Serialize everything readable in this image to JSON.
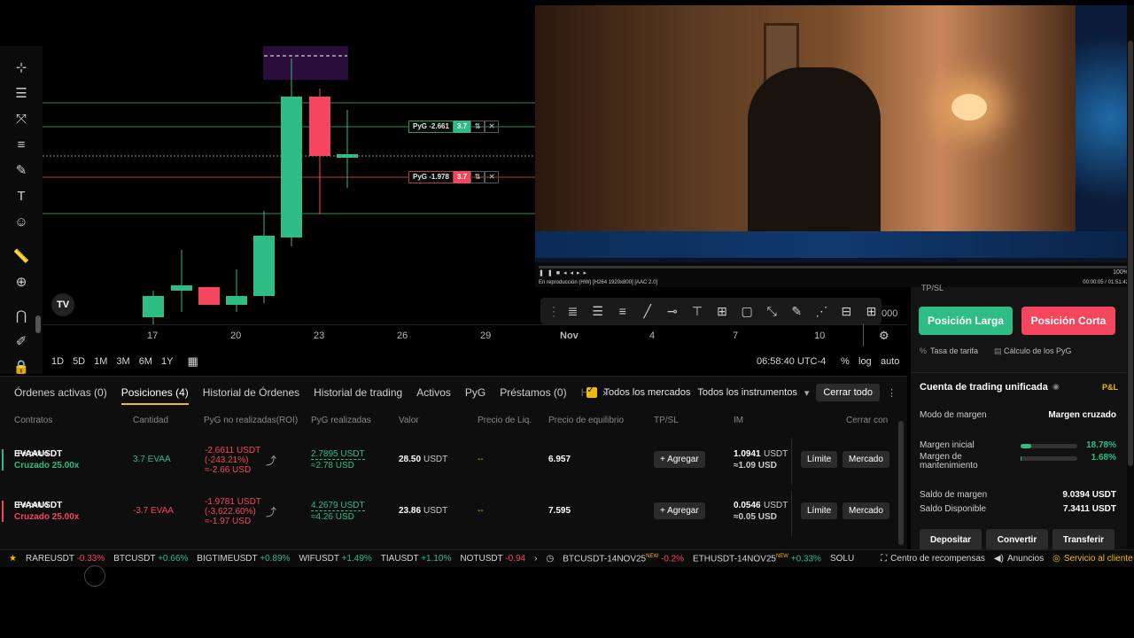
{
  "toolbar_icons": [
    "cursor-cross-icon",
    "horizontal-lines-icon",
    "pattern-icon",
    "parallel-lines-icon",
    "brush-icon",
    "text-icon",
    "emoji-icon",
    "ruler-icon",
    "zoom-in-icon",
    "magnet-icon",
    "edit-pencil-icon",
    "lock-icon"
  ],
  "chart": {
    "xaxis_ticks": [
      "17",
      "20",
      "23",
      "26",
      "29",
      "Nov",
      "4",
      "7",
      "10"
    ],
    "price_right_partial": "000",
    "pyg_long": {
      "label": "PyG -2.661",
      "qty": "3.7"
    },
    "pyg_short": {
      "label": "PyG -1.978",
      "qty": "3.7"
    },
    "timeframes": [
      "1D",
      "5D",
      "1M",
      "3M",
      "6M",
      "1Y"
    ],
    "clock": "06:58:40 UTC-4",
    "percent": "%",
    "log": "log",
    "auto": "auto",
    "colors": {
      "up": "#2ebd85",
      "down": "#f6465d"
    }
  },
  "video": {
    "status": "En reproducción (HW)   [H264 1920x800]   [AAC 2.0]",
    "time": "00:00:05 / 01:51:42",
    "volume": "100%"
  },
  "orders": {
    "tabs": [
      "Órdenes activas (0)",
      "Posiciones (4)",
      "Historial de Órdenes",
      "Historial de trading",
      "Activos",
      "PyG",
      "Préstamos (0)",
      "H"
    ],
    "active_tab": 1,
    "filter_all_markets": "Todos los mercados",
    "filter_instruments": "Todos los instrumentos",
    "close_all": "Cerrar todo",
    "headers": [
      "Contratos",
      "Cantidad",
      "PyG no realizadas(ROI)",
      "PyG realizadas",
      "Valor",
      "Precio de Liq.",
      "Precio de equilibrio",
      "TP/SL",
      "IM",
      "Cerrar con"
    ],
    "rows": [
      {
        "symbol": "EVAAUSDT",
        "type": "Perpetuo",
        "margin": "Cruzado 25.00x",
        "qty": "3.7 EVAA",
        "upnl": "-2.6611 USDT",
        "roi": "(-243.21%)",
        "upnl_usd": "≈-2.66 USD",
        "rpnl": "2.7895 USDT",
        "rpnl_usd": "≈2.78 USD",
        "value": "28.50",
        "value_unit": "USDT",
        "liq": "--",
        "entry": "6.957",
        "tpsl": "+ Agregar",
        "im": "1.0941",
        "im_unit": "USDT",
        "im_usd": "≈1.09 USD",
        "limit": "Límite",
        "market": "Mercado",
        "side": "long"
      },
      {
        "symbol": "EVAAUSDT",
        "type": "Perpetuo",
        "margin": "Cruzado 25.00x",
        "qty": "-3.7 EVAA",
        "upnl": "-1.9781 USDT",
        "roi": "(-3,622.60%)",
        "upnl_usd": "≈-1.97 USD",
        "rpnl": "4.2679 USDT",
        "rpnl_usd": "≈4.26 USD",
        "value": "23.86",
        "value_unit": "USDT",
        "liq": "--",
        "entry": "7.595",
        "tpsl": "+ Agregar",
        "im": "0.0546",
        "im_unit": "USDT",
        "im_usd": "≈0.05 USD",
        "limit": "Límite",
        "market": "Mercado",
        "side": "short"
      }
    ]
  },
  "trade_panel": {
    "tpsl_partial": "TP/SL",
    "long_btn": "Posición Larga",
    "short_btn": "Posición Corta",
    "fee_rate": "Tasa de tarifa",
    "pnl_calc": "Cálculo de los PyG",
    "account_title": "Cuenta de trading unificada",
    "pnl_link": "P&L",
    "margin_mode_label": "Modo de margen",
    "margin_mode_value": "Margen cruzado",
    "initial_margin_label": "Margen inicial",
    "initial_margin_pct": "18.78%",
    "initial_margin_fill": 0.1878,
    "maint_margin_label": "Margen de mantenimiento",
    "maint_margin_pct": "1.68%",
    "maint_margin_fill": 0.0168,
    "margin_balance_label": "Saldo de margen",
    "margin_balance": "9.0394 USDT",
    "available_label": "Saldo Disponible",
    "available": "7.3411 USDT",
    "deposit": "Depositar",
    "convert": "Convertir",
    "transfer": "Transferir"
  },
  "ticker": [
    {
      "sym": "RAREUSDT",
      "chg": "-0.33%",
      "dir": "down"
    },
    {
      "sym": "BTCUSDT",
      "chg": "+0.66%",
      "dir": "up"
    },
    {
      "sym": "BIGTIMEUSDT",
      "chg": "+0.89%",
      "dir": "up"
    },
    {
      "sym": "WIFUSDT",
      "chg": "+1.49%",
      "dir": "up"
    },
    {
      "sym": "TIAUSDT",
      "chg": "+1.10%",
      "dir": "up"
    },
    {
      "sym": "NOTUSDT",
      "chg": "-0.94",
      "dir": "down"
    },
    {
      "sym": "BTCUSDT-14NOV25",
      "chg": "-0.2%",
      "dir": "down",
      "new": "NEW"
    },
    {
      "sym": "ETHUSDT-14NOV25",
      "chg": "+0.33%",
      "dir": "up",
      "new": "NEW"
    },
    {
      "sym": "SOLU",
      "chg": "",
      "dir": "up"
    }
  ],
  "footer": {
    "rewards": "Centro de recompensas",
    "announcements": "Anuncios",
    "support": "Servicio al cliente"
  }
}
